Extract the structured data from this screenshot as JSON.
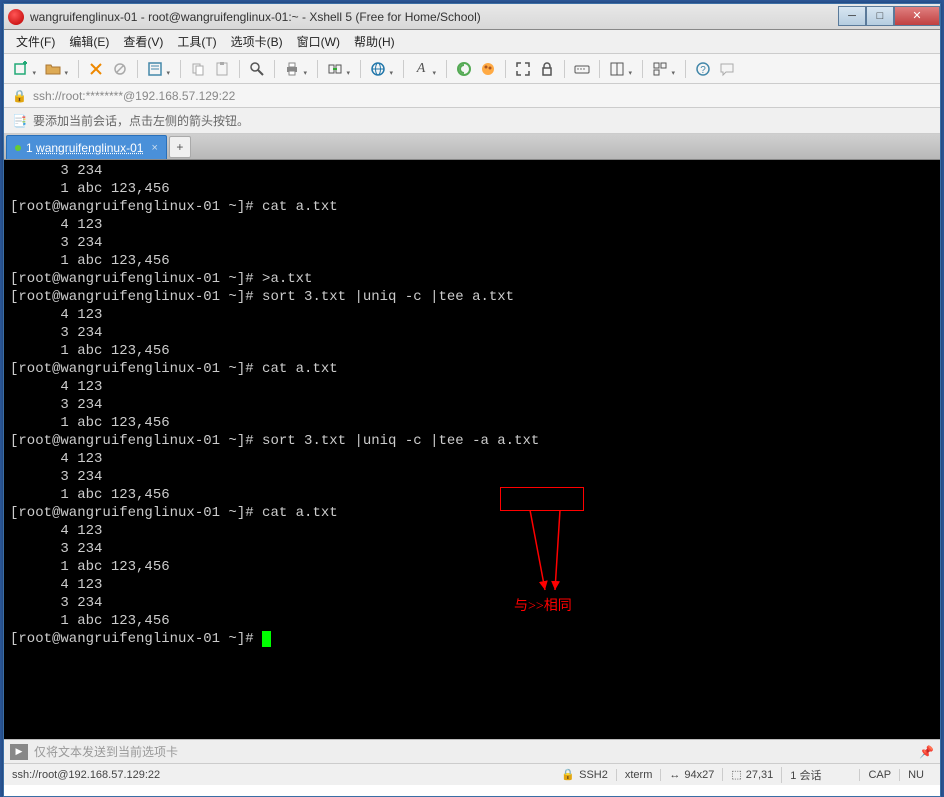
{
  "window": {
    "title": "wangruifenglinux-01 - root@wangruifenglinux-01:~ - Xshell 5 (Free for Home/School)"
  },
  "menubar": {
    "items": [
      "文件(F)",
      "编辑(E)",
      "查看(V)",
      "工具(T)",
      "选项卡(B)",
      "窗口(W)",
      "帮助(H)"
    ]
  },
  "addressbar": {
    "text": "ssh://root:********@192.168.57.129:22"
  },
  "infobar": {
    "text": "要添加当前会话，点击左侧的箭头按钮。"
  },
  "tab": {
    "index": "1",
    "label": "wangruifenglinux-01"
  },
  "terminal": {
    "lines": [
      "      3 234",
      "      1 abc 123,456",
      "[root@wangruifenglinux-01 ~]# cat a.txt",
      "      4 123",
      "      3 234",
      "      1 abc 123,456",
      "[root@wangruifenglinux-01 ~]# >a.txt",
      "[root@wangruifenglinux-01 ~]# sort 3.txt |uniq -c |tee a.txt",
      "      4 123",
      "      3 234",
      "      1 abc 123,456",
      "[root@wangruifenglinux-01 ~]# cat a.txt",
      "      4 123",
      "      3 234",
      "      1 abc 123,456",
      "[root@wangruifenglinux-01 ~]# sort 3.txt |uniq -c |tee -a a.txt",
      "      4 123",
      "      3 234",
      "      1 abc 123,456",
      "[root@wangruifenglinux-01 ~]# cat a.txt",
      "      4 123",
      "      3 234",
      "      1 abc 123,456",
      "      4 123",
      "      3 234",
      "      1 abc 123,456",
      "[root@wangruifenglinux-01 ~]# "
    ],
    "annotation_text": "与>>相同"
  },
  "inputbar": {
    "placeholder": "仅将文本发送到当前选项卡"
  },
  "statusbar": {
    "connection": "ssh://root@192.168.57.129:22",
    "protocol": "SSH2",
    "term": "xterm",
    "size": "94x27",
    "pos": "27,31",
    "sessions": "1 会话",
    "caps": "CAP",
    "num": "NU"
  }
}
